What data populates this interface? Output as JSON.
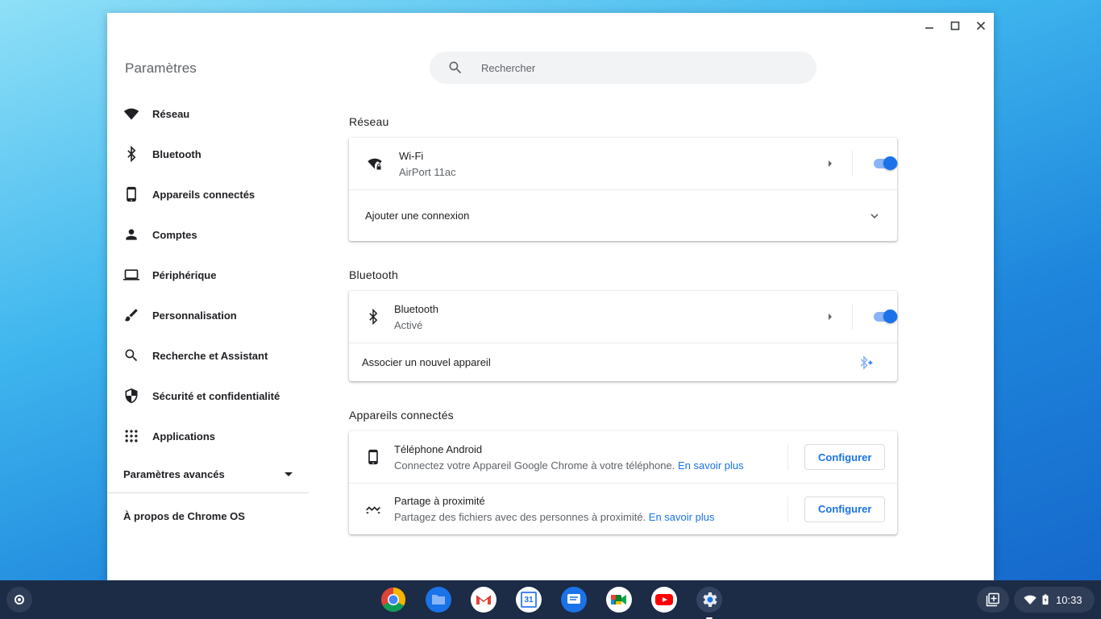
{
  "app_title": "Paramètres",
  "search": {
    "placeholder": "Rechercher"
  },
  "sidebar": {
    "items": [
      {
        "label": "Réseau",
        "icon": "wifi-icon"
      },
      {
        "label": "Bluetooth",
        "icon": "bluetooth-icon"
      },
      {
        "label": "Appareils connectés",
        "icon": "phone-icon"
      },
      {
        "label": "Comptes",
        "icon": "person-icon"
      },
      {
        "label": "Périphérique",
        "icon": "laptop-icon"
      },
      {
        "label": "Personnalisation",
        "icon": "brush-icon"
      },
      {
        "label": "Recherche et Assistant",
        "icon": "search-icon"
      },
      {
        "label": "Sécurité et confidentialité",
        "icon": "shield-icon"
      },
      {
        "label": "Applications",
        "icon": "apps-grid-icon"
      }
    ],
    "advanced_label": "Paramètres avancés",
    "about_label": "À propos de Chrome OS"
  },
  "network": {
    "title": "Réseau",
    "wifi_label": "Wi-Fi",
    "wifi_network": "AirPort 11ac",
    "wifi_enabled": true,
    "add_connection_label": "Ajouter une connexion"
  },
  "bluetooth": {
    "title": "Bluetooth",
    "label": "Bluetooth",
    "status": "Activé",
    "enabled": true,
    "pair_label": "Associer un nouvel appareil"
  },
  "connected_devices": {
    "title": "Appareils connectés",
    "android": {
      "label": "Téléphone Android",
      "desc": "Connectez votre Appareil Google Chrome à votre téléphone.",
      "link": "En savoir plus",
      "button": "Configurer"
    },
    "nearby": {
      "label": "Partage à proximité",
      "desc": "Partagez des fichiers avec des personnes à proximité.",
      "link": "En savoir plus",
      "button": "Configurer"
    }
  },
  "shelf": {
    "apps": [
      "chrome-icon",
      "files-icon",
      "gmail-icon",
      "calendar-icon",
      "messages-icon",
      "meet-icon",
      "youtube-icon",
      "settings-icon"
    ],
    "calendar_day": "31",
    "time": "10:33"
  },
  "colors": {
    "accent": "#1a73e8",
    "toggle_track": "#8ab4f8",
    "shelf": "#1c2b46"
  }
}
